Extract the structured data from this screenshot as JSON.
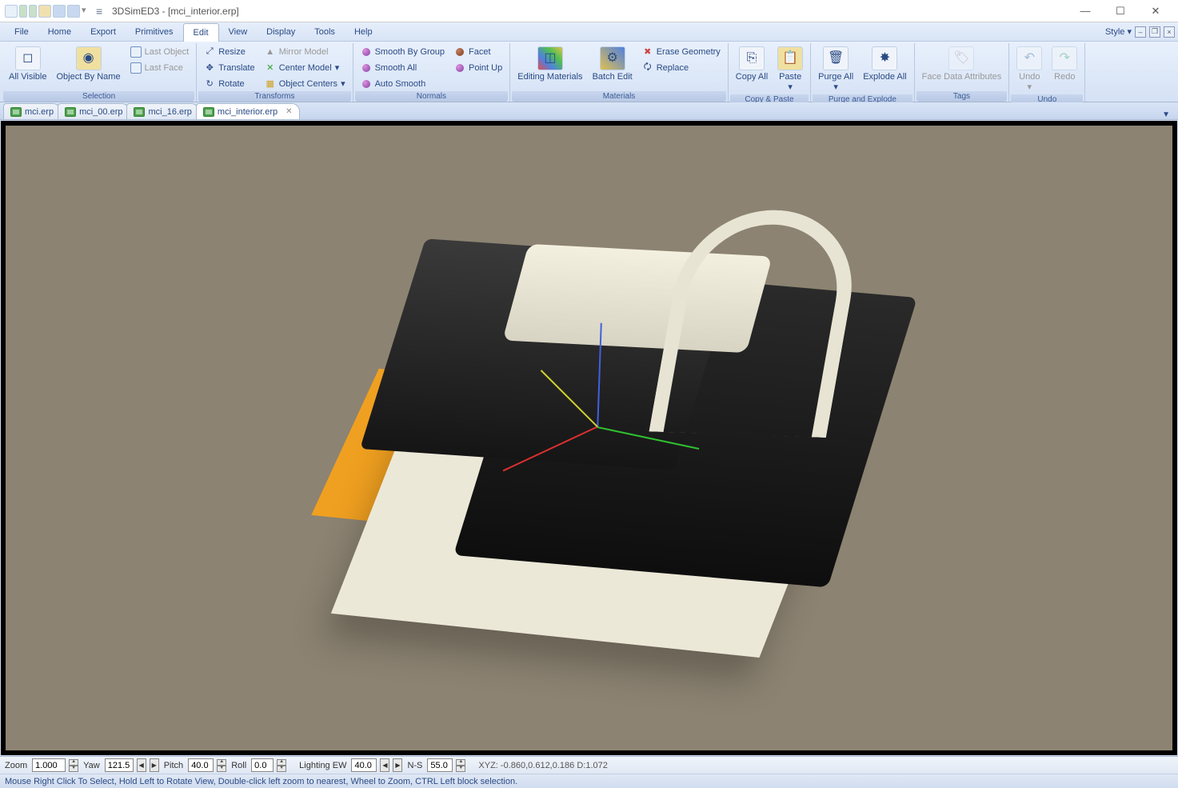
{
  "title": "3DSimED3 - [mci_interior.erp]",
  "win": {
    "style_label": "Style"
  },
  "menu": {
    "items": [
      "File",
      "Home",
      "Export",
      "Primitives",
      "Edit",
      "View",
      "Display",
      "Tools",
      "Help"
    ],
    "active": "Edit"
  },
  "ribbon": {
    "groups": [
      {
        "name": "Selection"
      },
      {
        "name": "Transforms"
      },
      {
        "name": "Normals"
      },
      {
        "name": "Materials"
      },
      {
        "name": "Copy & Paste"
      },
      {
        "name": "Purge and Explode"
      },
      {
        "name": "Tags"
      },
      {
        "name": "Undo"
      }
    ],
    "selection": {
      "all_visible": "All Visible",
      "object_by_name": "Object By Name",
      "last_object": "Last Object",
      "last_face": "Last Face"
    },
    "transforms": {
      "resize": "Resize",
      "translate": "Translate",
      "rotate": "Rotate",
      "mirror_model": "Mirror Model",
      "center_model": "Center Model",
      "object_centers": "Object Centers"
    },
    "normals": {
      "smooth_by_group": "Smooth By Group",
      "smooth_all": "Smooth All",
      "auto_smooth": "Auto Smooth",
      "facet": "Facet",
      "point_up": "Point Up"
    },
    "materials": {
      "editing_materials": "Editing Materials",
      "batch_edit": "Batch Edit",
      "erase_geometry": "Erase Geometry",
      "replace": "Replace"
    },
    "copy_paste": {
      "copy_all": "Copy All",
      "paste": "Paste"
    },
    "purge_explode": {
      "purge_all": "Purge All",
      "explode_all": "Explode All"
    },
    "tags": {
      "face_data_attributes": "Face Data Attributes"
    },
    "undo": {
      "undo": "Undo",
      "redo": "Redo"
    }
  },
  "tabs": [
    {
      "label": "mci.erp",
      "active": false
    },
    {
      "label": "mci_00.erp",
      "active": false
    },
    {
      "label": "mci_16.erp",
      "active": false
    },
    {
      "label": "mci_interior.erp",
      "active": true
    }
  ],
  "footer": {
    "zoom_label": "Zoom",
    "zoom": "1.000",
    "yaw_label": "Yaw",
    "yaw": "121.5",
    "pitch_label": "Pitch",
    "pitch": "40.0",
    "roll_label": "Roll",
    "roll": "0.0",
    "lighting_label": "Lighting EW",
    "lighting": "40.0",
    "ns_label": "N-S",
    "ns": "55.0",
    "coords": "XYZ: -0.860,0.612,0.186 D:1.072"
  },
  "status": "Mouse Right Click To Select, Hold Left to Rotate View, Double-click left  zoom to nearest, Wheel to Zoom, CTRL Left block selection."
}
